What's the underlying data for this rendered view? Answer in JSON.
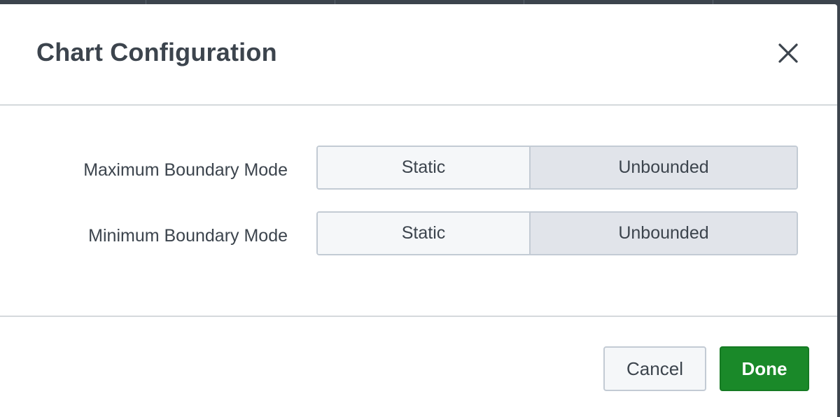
{
  "dialog": {
    "title": "Chart Configuration",
    "close_icon": "close-icon"
  },
  "settings": {
    "rows": [
      {
        "label": "Maximum Boundary Mode",
        "options": [
          "Static",
          "Unbounded"
        ],
        "selected": "Unbounded"
      },
      {
        "label": "Minimum Boundary Mode",
        "options": [
          "Static",
          "Unbounded"
        ],
        "selected": "Unbounded"
      }
    ]
  },
  "footer": {
    "cancel_label": "Cancel",
    "done_label": "Done"
  },
  "colors": {
    "primary": "#1a8929",
    "text": "#3c444d",
    "selected_segment": "#e1e4ea",
    "unselected_segment": "#f5f7f9"
  }
}
